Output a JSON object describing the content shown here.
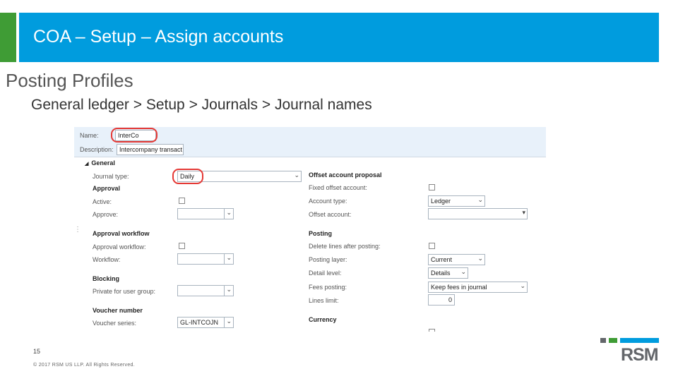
{
  "header": {
    "title": "COA – Setup – Assign accounts",
    "accent": "#009cde",
    "green": "#3f9c35"
  },
  "section_title": "Posting Profiles",
  "breadcrumb": "General ledger > Setup > Journals > Journal names",
  "form": {
    "name_label": "Name:",
    "name_value": "InterCo",
    "description_label": "Description:",
    "description_value": "Intercompany transact",
    "general_header": "General",
    "journal_type_label": "Journal type:",
    "journal_type_value": "Daily",
    "approval_header": "Approval",
    "active_label": "Active:",
    "approve_label": "Approve:",
    "approval_workflow_header": "Approval workflow",
    "approval_workflow_label": "Approval workflow:",
    "workflow_label": "Workflow:",
    "blocking_header": "Blocking",
    "private_label": "Private for user group:",
    "voucher_number_header": "Voucher number",
    "voucher_series_label": "Voucher series:",
    "voucher_series_value": "GL-INTCOJN",
    "offset_header": "Offset account proposal",
    "fixed_offset_label": "Fixed offset account:",
    "account_type_label": "Account type:",
    "account_type_value": "Ledger",
    "offset_account_label": "Offset account:",
    "posting_header": "Posting",
    "delete_lines_label": "Delete lines after posting:",
    "posting_layer_label": "Posting layer:",
    "posting_layer_value": "Current",
    "detail_level_label": "Detail level:",
    "detail_level_value": "Details",
    "fees_posting_label": "Fees posting:",
    "fees_posting_value": "Keep fees in journal",
    "lines_limit_label": "Lines limit:",
    "lines_limit_value": "0",
    "currency_header": "Currency"
  },
  "footer": {
    "slide_number": "15",
    "copyright": "© 2017 RSM US LLP. All Rights Reserved."
  },
  "logo": {
    "text": "RSM"
  },
  "icons": {
    "dropdown": "chevron-down-icon",
    "collapse": "triangle-collapse-icon"
  }
}
